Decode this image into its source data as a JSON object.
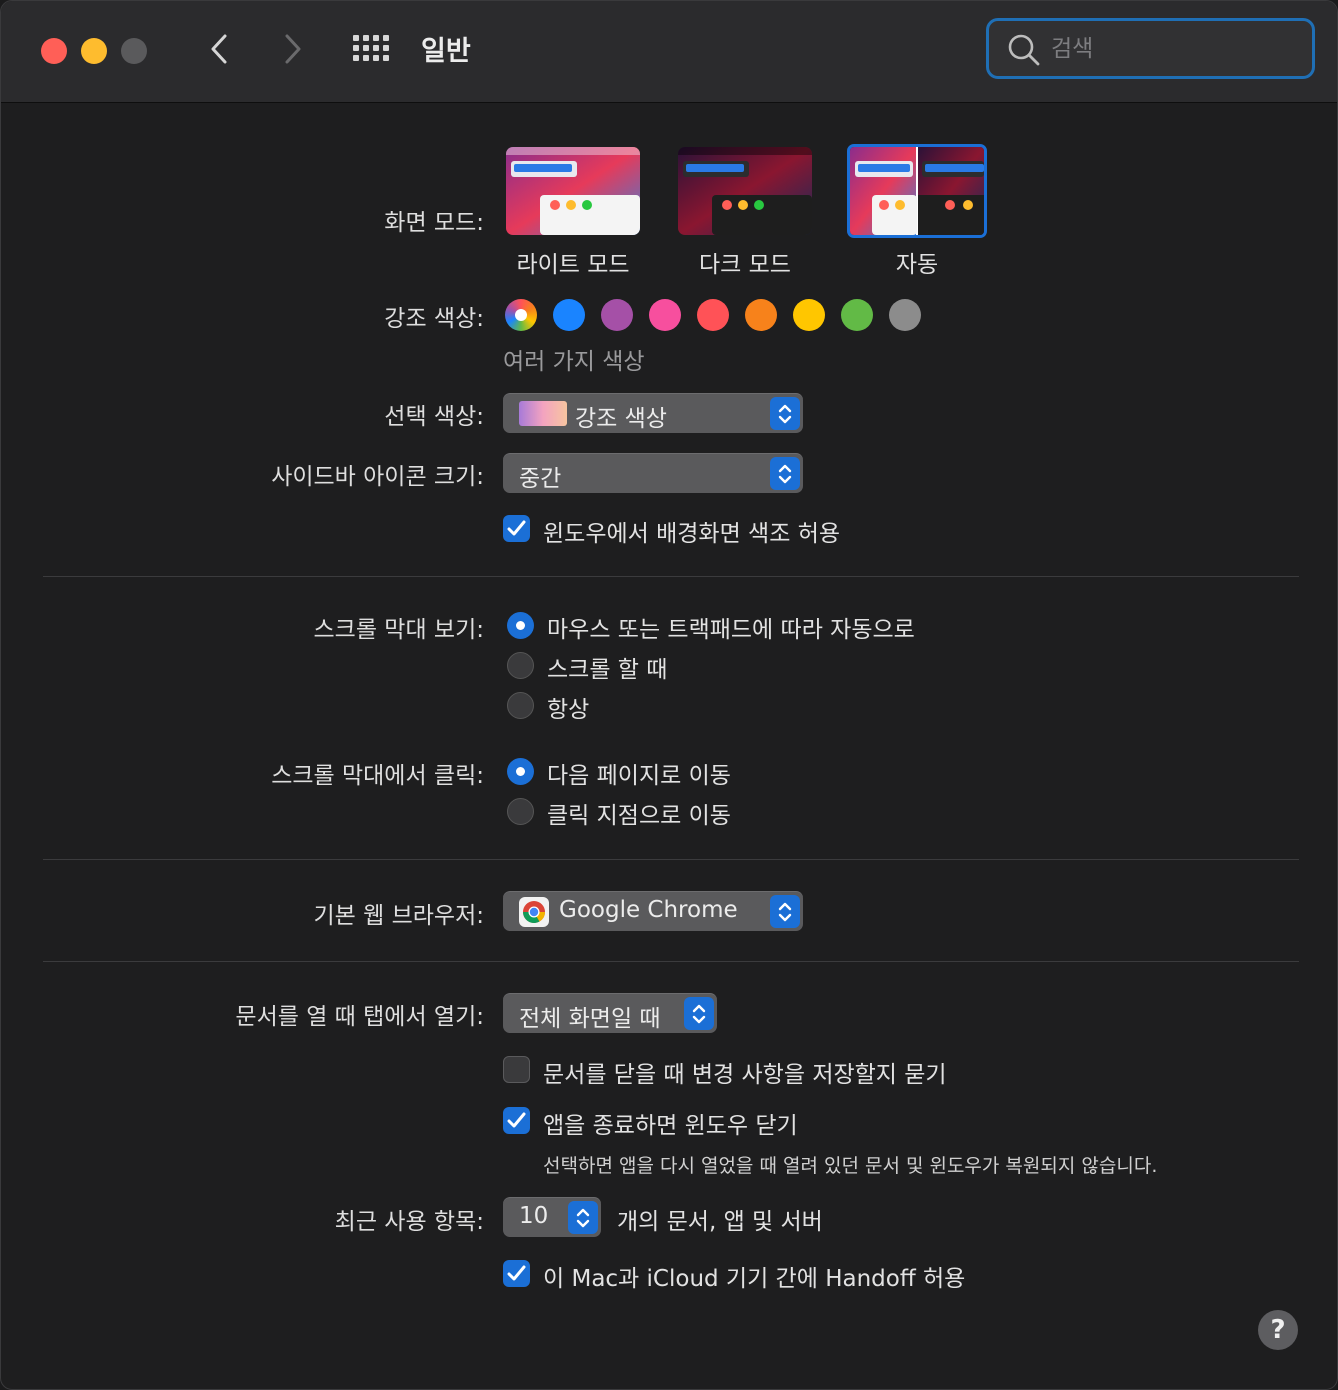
{
  "window": {
    "title": "일반"
  },
  "search": {
    "placeholder": "검색"
  },
  "appearance": {
    "label": "화면 모드:",
    "options": [
      {
        "label": "라이트 모드",
        "selected": false
      },
      {
        "label": "다크 모드",
        "selected": false
      },
      {
        "label": "자동",
        "selected": true
      }
    ]
  },
  "accent": {
    "label": "강조 색상:",
    "caption": "여러 가지 색상",
    "colors": [
      "multicolor",
      "#1a84ff",
      "#a550a7",
      "#f74f9e",
      "#ff5257",
      "#f7821b",
      "#ffc600",
      "#62ba46",
      "#8c8c8c"
    ],
    "selected": 0
  },
  "highlight": {
    "label": "선택 색상:",
    "value": "강조 색상"
  },
  "sidebar_size": {
    "label": "사이드바 아이콘 크기:",
    "value": "중간"
  },
  "tinting": {
    "label": "윈도우에서 배경화면 색조 허용",
    "checked": true
  },
  "show_scrollbars": {
    "label": "스크롤 막대 보기:",
    "options": [
      {
        "label": "마우스 또는 트랙패드에 따라 자동으로",
        "selected": true
      },
      {
        "label": "스크롤 할 때",
        "selected": false
      },
      {
        "label": "항상",
        "selected": false
      }
    ]
  },
  "click_scrollbar": {
    "label": "스크롤 막대에서 클릭:",
    "options": [
      {
        "label": "다음 페이지로 이동",
        "selected": true
      },
      {
        "label": "클릭 지점으로 이동",
        "selected": false
      }
    ]
  },
  "browser": {
    "label": "기본 웹 브라우저:",
    "value": "Google Chrome",
    "icon": "chrome-icon"
  },
  "tabs": {
    "label": "문서를 열 때 탭에서 열기:",
    "value": "전체 화면일 때"
  },
  "ask_save": {
    "label": "문서를 닫을 때 변경 사항을 저장할지 묻기",
    "checked": false
  },
  "close_windows": {
    "label": "앱을 종료하면 윈도우 닫기",
    "checked": true,
    "note": "선택하면 앱을 다시 열었을 때 열려 있던 문서 및 윈도우가 복원되지 않습니다."
  },
  "recent": {
    "label": "최근 사용 항목:",
    "value": "10",
    "suffix": "개의 문서, 앱 및 서버"
  },
  "handoff": {
    "label": "이 Mac과 iCloud 기기 간에 Handoff 허용",
    "checked": true
  },
  "help": {
    "label": "?"
  },
  "colors": {
    "accent": "#1b6fd6",
    "background": "#1e1e1f",
    "titlebar": "#2b2b2d"
  }
}
